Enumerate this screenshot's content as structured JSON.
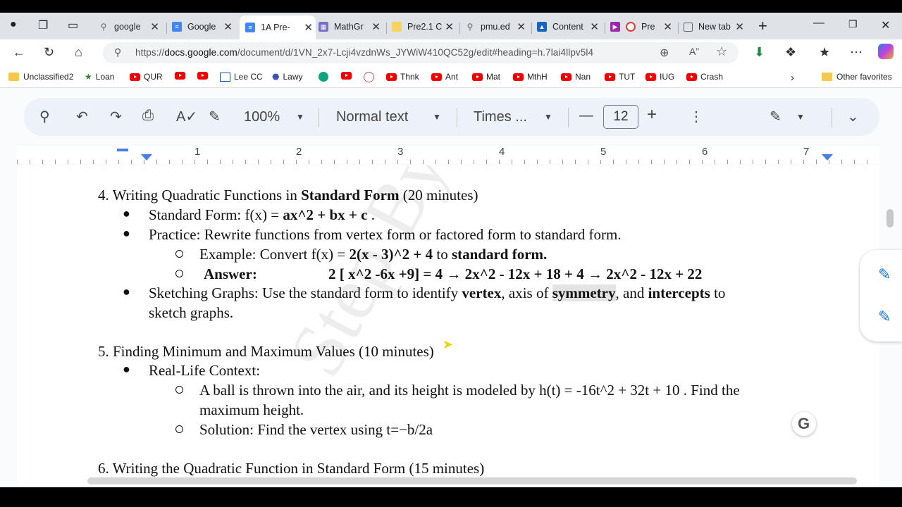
{
  "browser": {
    "tabs": [
      {
        "title": "google",
        "fav": "search-icon",
        "color": "#5f6368"
      },
      {
        "title": "Google",
        "fav": "docs-icon",
        "color": "#4285f4"
      },
      {
        "title": "1A Pre-",
        "fav": "docs-icon",
        "color": "#4285f4"
      },
      {
        "title": "MathGr",
        "fav": "grid-icon",
        "color": "#7b6fc4"
      },
      {
        "title": "Pre2.1 C",
        "fav": "slides-icon",
        "color": "#f4b400"
      },
      {
        "title": "pmu.ed",
        "fav": "search-icon",
        "color": "#5f6368"
      },
      {
        "title": "Content",
        "fav": "triangle-icon",
        "color": "#1565c0"
      },
      {
        "title": "Pre",
        "fav": "record-icon",
        "color": "#9c27b0"
      },
      {
        "title": "New tab",
        "fav": "newtab-icon",
        "color": "#666"
      }
    ],
    "url_prefix": "https://",
    "url_domain": "docs.google.com",
    "url_rest": "/document/d/1VN_2x7-Lcji4vzdnWs_JYWiW410QC52g/edit#heading=h.7lai4llpv5l4",
    "bookmarks": [
      "Unclassified2",
      "Loan",
      "QUR",
      "",
      "",
      "Lee CC",
      "Lawy",
      "",
      "",
      "",
      "Thnk",
      "Ant",
      "Mat",
      "MthH",
      "Nan",
      "TUT",
      "IUG",
      "Crash"
    ],
    "other_favorites": "Other favorites"
  },
  "docs": {
    "zoom": "100%",
    "style": "Normal text",
    "font": "Times ...",
    "font_size": "12",
    "ruler": [
      "1",
      "2",
      "3",
      "4",
      "5",
      "6",
      "7"
    ]
  },
  "content": {
    "s4_title_a": "4. Writing Quadratic Functions in ",
    "s4_title_b": "Standard Form",
    "s4_title_c": " (20 minutes)",
    "s4_b1_a": "Standard Form:  f(x) = ",
    "s4_b1_b": "ax^2 + bx + c",
    "s4_b1_c": " .",
    "s4_b2": "Practice: Rewrite functions from vertex form or factored form to standard form.",
    "s4_ex_a": "Example: Convert  f(x) = ",
    "s4_ex_b": "2(x - 3)^2 + 4",
    "s4_ex_c": "  to ",
    "s4_ex_d": "standard form.",
    "s4_ans_label": "Answer:",
    "s4_ans_eq": "2 [ x^2 -6x +9] = 4   → 2x^2 - 12x + 18 + 4  → 2x^2 - 12x + 22",
    "s4_b3_a": "Sketching Graphs: Use the standard form to identify ",
    "s4_b3_b": "vertex",
    "s4_b3_c": ", axis of ",
    "s4_b3_d": "symmetry",
    "s4_b3_e": ", and ",
    "s4_b3_f": "intercepts",
    "s4_b3_g": " to",
    "s4_b3_h": "sketch graphs.",
    "s5_title": "5. Finding Minimum and Maximum Values (10 minutes)",
    "s5_b1": "Real-Life Context:",
    "s5_c1_a": "A ball is thrown into the air, and its height is modeled by  h(t) = -16t^2 + 32t + 10 . Find the",
    "s5_c1_b": "maximum height.",
    "s5_c2": "Solution: Find the vertex using t=−b/2a",
    "s6_title": "6. Writing the Quadratic Function in Standard Form (15 minutes)",
    "watermark": "Step By Step"
  }
}
